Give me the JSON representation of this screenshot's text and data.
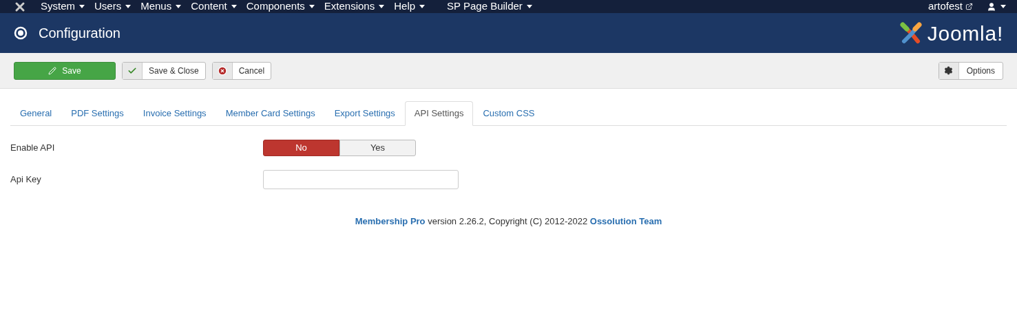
{
  "menu_bar": {
    "items": [
      "System",
      "Users",
      "Menus",
      "Content",
      "Components",
      "Extensions",
      "Help",
      "SP Page Builder"
    ],
    "site_link": "artofest"
  },
  "header": {
    "title": "Configuration",
    "logo_text": "Joomla!"
  },
  "toolbar": {
    "buttons": [
      {
        "label": "Save",
        "kind": "primary"
      },
      {
        "label": "Save & Close",
        "kind": "check"
      },
      {
        "label": "Cancel",
        "kind": "cancel"
      }
    ],
    "options_button": "Options"
  },
  "tabs": [
    {
      "label": "General",
      "selected": false
    },
    {
      "label": "PDF Settings",
      "selected": false
    },
    {
      "label": "Invoice Settings",
      "selected": false
    },
    {
      "label": "Member Card Settings",
      "selected": false
    },
    {
      "label": "Export Settings",
      "selected": false
    },
    {
      "label": "API Settings",
      "selected": true
    },
    {
      "label": "Custom CSS",
      "selected": false
    }
  ],
  "fields": [
    {
      "label": "Enable API",
      "kind": "toggle",
      "options": [
        {
          "label": "No",
          "selected": true
        },
        {
          "label": "Yes",
          "selected": false
        }
      ]
    },
    {
      "label": "Api Key",
      "kind": "text"
    }
  ],
  "footer": {
    "product_link": "Membership Pro",
    "text": "version 2.26.2, Copyright (C) 2012-2022",
    "team_link": "Ossolution Team"
  }
}
